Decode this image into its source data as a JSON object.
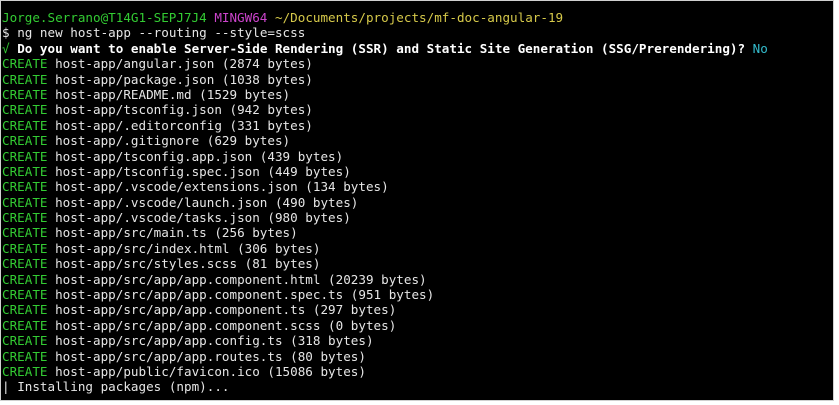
{
  "prompt": {
    "user_host": "Jorge.Serrano@T14G1-SEPJ7J4",
    "shell": "MINGW64",
    "path": "~/Documents/projects/mf-doc-angular-19"
  },
  "command": {
    "symbol": "$",
    "text": "ng new host-app --routing --style=scss"
  },
  "question": {
    "mark": "√",
    "text": "Do you want to enable Server-Side Rendering (SSR) and Static Site Generation (SSG/Prerendering)?",
    "answer": "No"
  },
  "create_label": "CREATE",
  "files": [
    "host-app/angular.json (2874 bytes)",
    "host-app/package.json (1038 bytes)",
    "host-app/README.md (1529 bytes)",
    "host-app/tsconfig.json (942 bytes)",
    "host-app/.editorconfig (331 bytes)",
    "host-app/.gitignore (629 bytes)",
    "host-app/tsconfig.app.json (439 bytes)",
    "host-app/tsconfig.spec.json (449 bytes)",
    "host-app/.vscode/extensions.json (134 bytes)",
    "host-app/.vscode/launch.json (490 bytes)",
    "host-app/.vscode/tasks.json (980 bytes)",
    "host-app/src/main.ts (256 bytes)",
    "host-app/src/index.html (306 bytes)",
    "host-app/src/styles.scss (81 bytes)",
    "host-app/src/app/app.component.html (20239 bytes)",
    "host-app/src/app/app.component.spec.ts (951 bytes)",
    "host-app/src/app/app.component.ts (297 bytes)",
    "host-app/src/app/app.component.scss (0 bytes)",
    "host-app/src/app/app.config.ts (318 bytes)",
    "host-app/src/app/app.routes.ts (80 bytes)",
    "host-app/public/favicon.ico (15086 bytes)"
  ],
  "status": {
    "spinner": "|",
    "text": "Installing packages (npm)..."
  },
  "colors": {
    "background": "#000000",
    "green": "#33cc33",
    "magenta": "#cc44cc",
    "yellow": "#d6c94a",
    "cyan": "#33bbcc",
    "text": "#e6e6e6"
  }
}
